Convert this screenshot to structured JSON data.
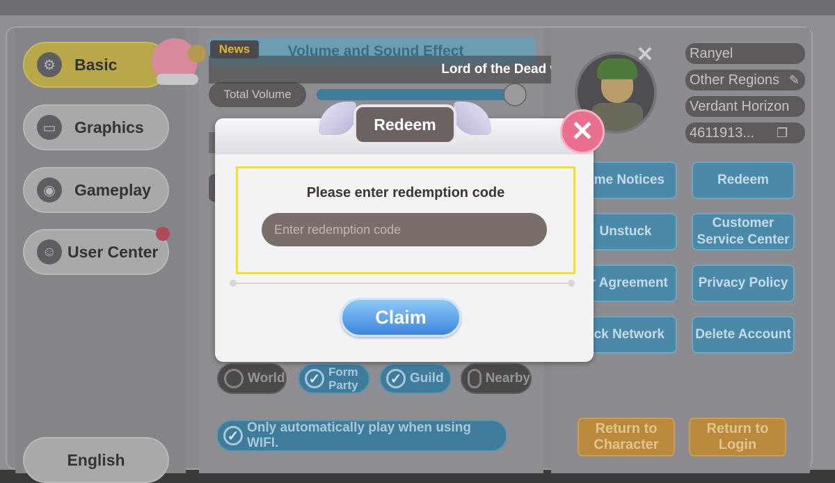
{
  "nav": {
    "basic": "Basic",
    "graphics": "Graphics",
    "gameplay": "Gameplay",
    "user_center": "User Center",
    "language": "English"
  },
  "settings": {
    "section_title": "Volume and Sound Effect",
    "total_volume_label": "Total Volume",
    "volume_level": 0.95
  },
  "news": {
    "tag": "News",
    "ticker": "Lord of the Dead will be sp"
  },
  "profile": {
    "name": "Ranyel",
    "region_link": "Other Regions",
    "server": "Verdant Horizon",
    "id": "4611913..."
  },
  "right_buttons": {
    "game_notices": "ame Notices",
    "redeem": "Redeem",
    "unstuck": "Unstuck",
    "customer_service": "Customer Service Center",
    "user_agreement": "er Agreement",
    "privacy_policy": "Privacy Policy",
    "check_network": "eck Network",
    "delete_account": "Delete Account",
    "return_character": "Return to Character",
    "return_login": "Return to Login"
  },
  "chat_channels": {
    "world": "World",
    "form_party": "Form Party",
    "guild": "Guild",
    "nearby": "Nearby"
  },
  "autoplay_label": "Only automatically play when using WIFI.",
  "modal": {
    "title": "Redeem",
    "prompt": "Please enter redemption code",
    "placeholder": "Enter redemption code",
    "claim": "Claim"
  },
  "colors": {
    "highlight": "#f4e21a",
    "claim_button": "#3d86e0",
    "close_button": "#ea6f8e"
  }
}
